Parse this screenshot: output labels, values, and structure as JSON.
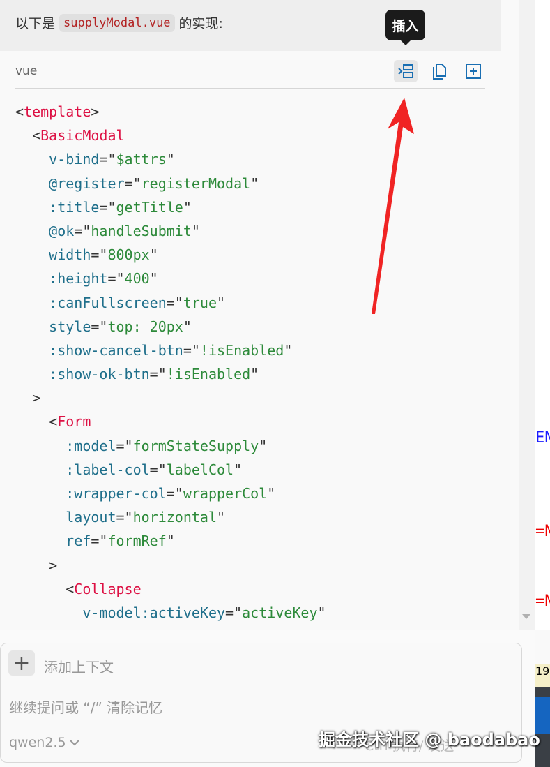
{
  "intro": {
    "prefix": "以下是",
    "filename": "supplyModal.vue",
    "suffix": "的实现:"
  },
  "codeblock": {
    "language": "vue",
    "tooltip": "插入",
    "buttons": [
      "insert-icon",
      "copy-icon",
      "new-file-icon"
    ],
    "accent_color": "#1a6fb3"
  },
  "code_lines": [
    [
      {
        "c": "p",
        "t": "<"
      },
      {
        "c": "t",
        "t": "template"
      },
      {
        "c": "p",
        "t": ">"
      }
    ],
    [
      {
        "c": "p",
        "t": "  <"
      },
      {
        "c": "t",
        "t": "BasicModal"
      }
    ],
    [
      {
        "c": "a",
        "t": "    v-bind"
      },
      {
        "c": "p",
        "t": "=\""
      },
      {
        "c": "s",
        "t": "$attrs"
      },
      {
        "c": "p",
        "t": "\""
      }
    ],
    [
      {
        "c": "a",
        "t": "    @register"
      },
      {
        "c": "p",
        "t": "=\""
      },
      {
        "c": "s",
        "t": "registerModal"
      },
      {
        "c": "p",
        "t": "\""
      }
    ],
    [
      {
        "c": "a",
        "t": "    :title"
      },
      {
        "c": "p",
        "t": "=\""
      },
      {
        "c": "s",
        "t": "getTitle"
      },
      {
        "c": "p",
        "t": "\""
      }
    ],
    [
      {
        "c": "a",
        "t": "    @ok"
      },
      {
        "c": "p",
        "t": "=\""
      },
      {
        "c": "s",
        "t": "handleSubmit"
      },
      {
        "c": "p",
        "t": "\""
      }
    ],
    [
      {
        "c": "a",
        "t": "    width"
      },
      {
        "c": "p",
        "t": "=\""
      },
      {
        "c": "s",
        "t": "800px"
      },
      {
        "c": "p",
        "t": "\""
      }
    ],
    [
      {
        "c": "a",
        "t": "    :height"
      },
      {
        "c": "p",
        "t": "=\""
      },
      {
        "c": "s",
        "t": "400"
      },
      {
        "c": "p",
        "t": "\""
      }
    ],
    [
      {
        "c": "a",
        "t": "    :canFullscreen"
      },
      {
        "c": "p",
        "t": "=\""
      },
      {
        "c": "s",
        "t": "true"
      },
      {
        "c": "p",
        "t": "\""
      }
    ],
    [
      {
        "c": "a",
        "t": "    style"
      },
      {
        "c": "p",
        "t": "=\""
      },
      {
        "c": "s",
        "t": "top: 20px"
      },
      {
        "c": "p",
        "t": "\""
      }
    ],
    [
      {
        "c": "a",
        "t": "    :show-cancel-btn"
      },
      {
        "c": "p",
        "t": "=\""
      },
      {
        "c": "s",
        "t": "!isEnabled"
      },
      {
        "c": "p",
        "t": "\""
      }
    ],
    [
      {
        "c": "a",
        "t": "    :show-ok-btn"
      },
      {
        "c": "p",
        "t": "=\""
      },
      {
        "c": "s",
        "t": "!isEnabled"
      },
      {
        "c": "p",
        "t": "\""
      }
    ],
    [
      {
        "c": "p",
        "t": "  >"
      }
    ],
    [
      {
        "c": "p",
        "t": "    <"
      },
      {
        "c": "t",
        "t": "Form"
      }
    ],
    [
      {
        "c": "a",
        "t": "      :model"
      },
      {
        "c": "p",
        "t": "=\""
      },
      {
        "c": "s",
        "t": "formStateSupply"
      },
      {
        "c": "p",
        "t": "\""
      }
    ],
    [
      {
        "c": "a",
        "t": "      :label-col"
      },
      {
        "c": "p",
        "t": "=\""
      },
      {
        "c": "s",
        "t": "labelCol"
      },
      {
        "c": "p",
        "t": "\""
      }
    ],
    [
      {
        "c": "a",
        "t": "      :wrapper-col"
      },
      {
        "c": "p",
        "t": "=\""
      },
      {
        "c": "s",
        "t": "wrapperCol"
      },
      {
        "c": "p",
        "t": "\""
      }
    ],
    [
      {
        "c": "a",
        "t": "      layout"
      },
      {
        "c": "p",
        "t": "=\""
      },
      {
        "c": "s",
        "t": "horizontal"
      },
      {
        "c": "p",
        "t": "\""
      }
    ],
    [
      {
        "c": "a",
        "t": "      ref"
      },
      {
        "c": "p",
        "t": "=\""
      },
      {
        "c": "s",
        "t": "formRef"
      },
      {
        "c": "p",
        "t": "\""
      }
    ],
    [
      {
        "c": "p",
        "t": "    >"
      }
    ],
    [
      {
        "c": "p",
        "t": "      <"
      },
      {
        "c": "t",
        "t": "Collapse"
      }
    ],
    [
      {
        "c": "a",
        "t": "        v-model:activeKey"
      },
      {
        "c": "p",
        "t": "=\""
      },
      {
        "c": "s",
        "t": "activeKey"
      },
      {
        "c": "p",
        "t": "\""
      }
    ]
  ],
  "background_edge": {
    "chars": [
      "EN",
      "=N",
      "=N"
    ],
    "badge": "19"
  },
  "input": {
    "add_context": "添加上下文",
    "placeholder": "继续提问或 “/” 清除记忆",
    "model": "qwen2.5",
    "send_hint": "Ctrl 执行/ 发送"
  },
  "watermark": "掘金技术社区 @ baodabao"
}
